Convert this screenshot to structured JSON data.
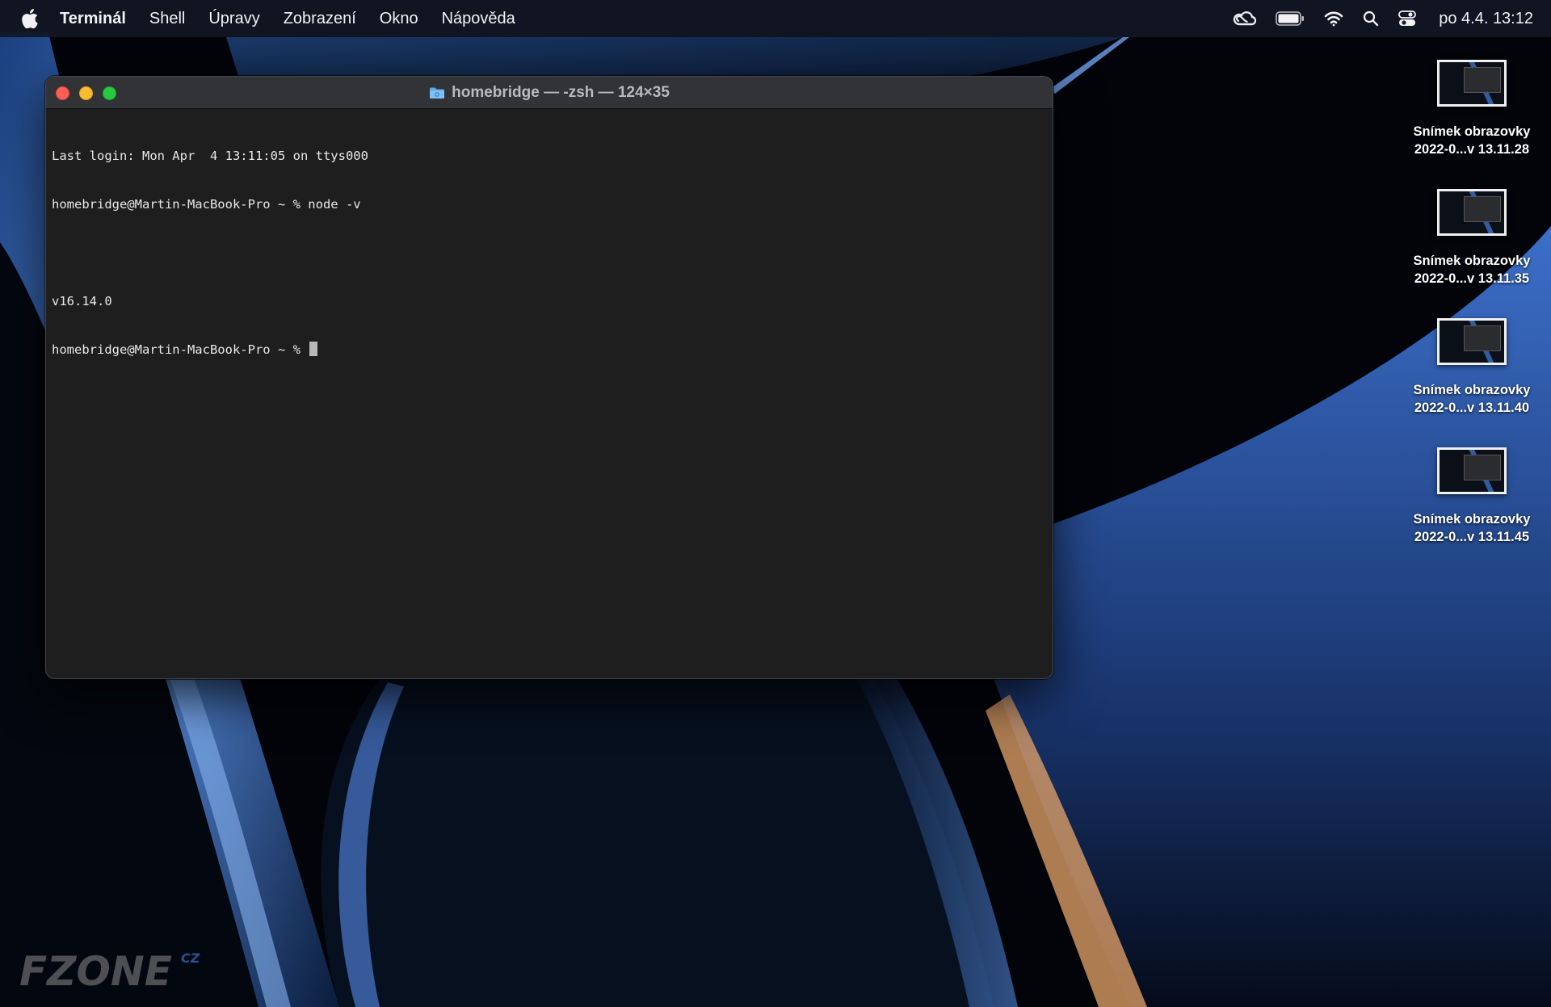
{
  "menubar": {
    "apple_icon": "apple-logo-icon",
    "items": [
      "Terminál",
      "Shell",
      "Úpravy",
      "Zobrazení",
      "Okno",
      "Nápověda"
    ],
    "status_icons": [
      "creative-cloud-icon",
      "battery-icon",
      "wifi-icon",
      "search-icon",
      "control-center-icon"
    ],
    "clock": "po 4.4.  13:12"
  },
  "window": {
    "title": "homebridge — -zsh — 124×35",
    "folder_icon": "folder-icon",
    "lines": [
      "Last login: Mon Apr  4 13:11:05 on ttys000",
      "homebridge@Martin-MacBook-Pro ~ % node -v",
      "",
      "v16.14.0",
      "homebridge@Martin-MacBook-Pro ~ % "
    ]
  },
  "desktop": {
    "icons": [
      {
        "label1": "Snímek obrazovky",
        "label2": "2022-0...v 13.11.28"
      },
      {
        "label1": "Snímek obrazovky",
        "label2": "2022-0...v 13.11.35"
      },
      {
        "label1": "Snímek obrazovky",
        "label2": "2022-0...v 13.11.40"
      },
      {
        "label1": "Snímek obrazovky",
        "label2": "2022-0...v 13.11.45"
      }
    ]
  },
  "watermark": {
    "text": "FZONE",
    "suffix": "CZ"
  },
  "colors": {
    "accent_blue": "#3a6fc4",
    "terminal_bg": "#1e1e1e",
    "close": "#ff5f57",
    "minimize": "#febc2e",
    "zoom": "#28c840"
  }
}
